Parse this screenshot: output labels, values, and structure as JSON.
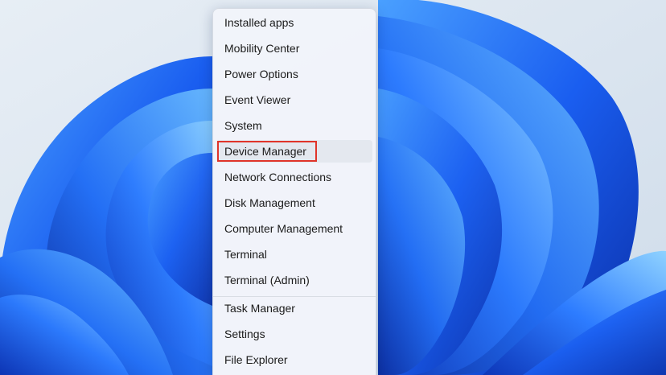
{
  "menu": {
    "items": [
      {
        "label": "Installed apps"
      },
      {
        "label": "Mobility Center"
      },
      {
        "label": "Power Options"
      },
      {
        "label": "Event Viewer"
      },
      {
        "label": "System"
      },
      {
        "label": "Device Manager"
      },
      {
        "label": "Network Connections"
      },
      {
        "label": "Disk Management"
      },
      {
        "label": "Computer Management"
      },
      {
        "label": "Terminal"
      },
      {
        "label": "Terminal (Admin)"
      },
      {
        "label": "Task Manager"
      },
      {
        "label": "Settings"
      },
      {
        "label": "File Explorer"
      }
    ],
    "highlighted_item": "Device Manager",
    "highlight_color": "#e0342a"
  },
  "wallpaper": {
    "name": "Windows 11 bloom",
    "accent": "#1a5ef0",
    "background": "#dfe8f1"
  }
}
